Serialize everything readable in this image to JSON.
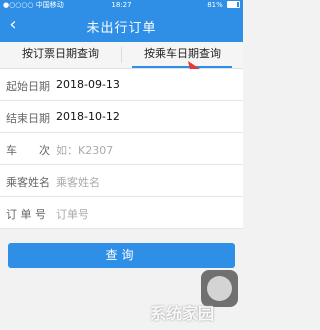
{
  "status_bar": {
    "carrier": "●○○○○ 中国移动",
    "time": "18:27",
    "battery": "81%"
  },
  "header": {
    "back_icon": "chevron-left-icon",
    "title": "未出行订单"
  },
  "tabs": [
    {
      "label": "按订票日期查询",
      "active": false
    },
    {
      "label": "按乘车日期查询",
      "active": true
    }
  ],
  "form": {
    "start_date": {
      "label": "起始日期",
      "value": "2018-09-13"
    },
    "end_date": {
      "label": "结束日期",
      "value": "2018-10-12"
    },
    "train": {
      "label": "车　　次",
      "placeholder": "如：K2307"
    },
    "passenger": {
      "label": "乘客姓名",
      "placeholder": "乘客姓名"
    },
    "order_no": {
      "label": "订 单 号",
      "placeholder": "订单号"
    }
  },
  "query_button": {
    "label": "查询"
  },
  "watermark": "系统家园",
  "colors": {
    "accent": "#2f8fe6",
    "annotation_arrow": "#e53935"
  }
}
